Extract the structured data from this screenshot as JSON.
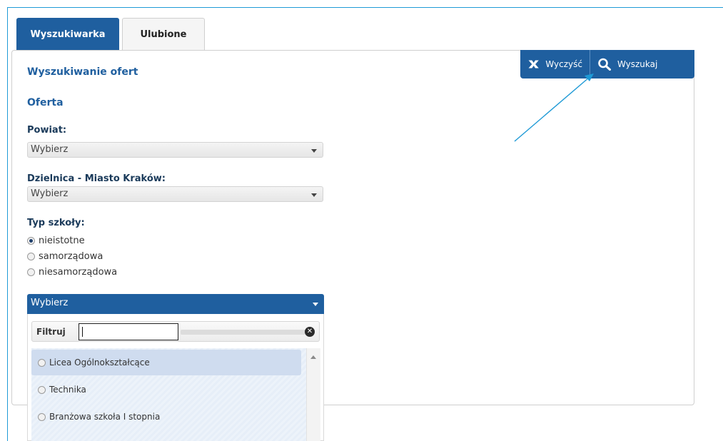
{
  "tabs": [
    {
      "label": "Wyszukiwarka",
      "active": true
    },
    {
      "label": "Ulubione",
      "active": false
    }
  ],
  "actions": {
    "clear_label": "Wyczyść",
    "search_label": "Wyszukaj"
  },
  "panel": {
    "title": "Wyszukiwanie ofert",
    "section": "Oferta"
  },
  "powiat": {
    "label": "Powiat:",
    "value": "Wybierz"
  },
  "dzielnica": {
    "label": "Dzielnica - Miasto Kraków:",
    "value": "Wybierz"
  },
  "school_type": {
    "label": "Typ szkoły:",
    "options": [
      {
        "label": "nieistotne",
        "checked": true
      },
      {
        "label": "samorządowa",
        "checked": false
      },
      {
        "label": "niesamorządowa",
        "checked": false
      }
    ]
  },
  "school_dropdown": {
    "value": "Wybierz",
    "filter_label": "Filtruj",
    "filter_value": "",
    "options": [
      {
        "label": "Licea Ogólnokształcące",
        "highlighted": true
      },
      {
        "label": "Technika",
        "highlighted": false
      },
      {
        "label": "Branżowa szkoła I stopnia",
        "highlighted": false
      }
    ]
  },
  "colors": {
    "primary": "#1f5f9f",
    "frame": "#1e9ad6",
    "highlight": "#cfdcef"
  },
  "icons": [
    "close-x-icon",
    "search-icon",
    "chevron-down-icon",
    "clear-filter-icon",
    "scroll-up-icon"
  ]
}
